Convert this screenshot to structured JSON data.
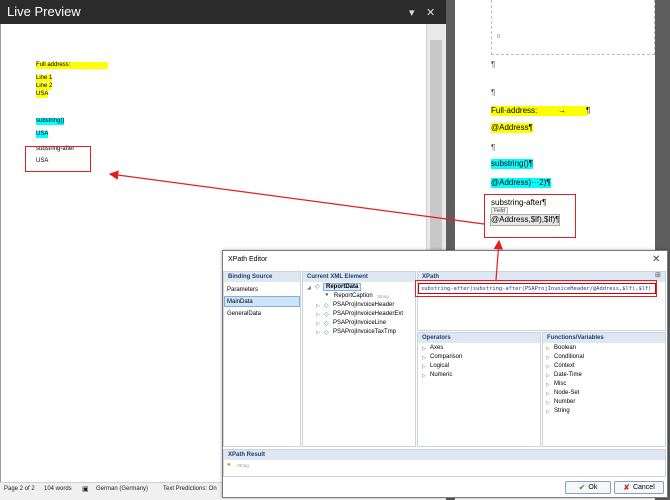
{
  "live_preview": {
    "title": "Live Preview",
    "lines": {
      "full_address": "Full address:",
      "line1": "Line 1",
      "line2": "Line 2",
      "usa1": "USA",
      "substring": "substring()",
      "usa2": "USA",
      "substring_after": "substring-after",
      "usa3": "USA"
    }
  },
  "document": {
    "placeholder": "¤",
    "para1": "¶",
    "para2": "¶",
    "full_address": "Full·address:",
    "tab": "→",
    "full_address_pilcrow": "¶",
    "address_field": "@Address¶",
    "para3": "¶",
    "substring": "substring()¶",
    "address_sub": "@Address)···2)¶",
    "substring_after": "substring-after¶",
    "field_tag": "Field",
    "field_text": "@Address,$lf),$lf)¶"
  },
  "status_bar": {
    "page": "Page 2 of 2",
    "words": "104 words",
    "language": "German (Germany)",
    "predictions": "Text Predictions: On"
  },
  "xpath_editor": {
    "title": "XPath Editor",
    "close": "✕",
    "binding_source": {
      "header": "Binding Source",
      "items": [
        "Parameters",
        "MainData",
        "GeneralData"
      ],
      "selected": "MainData"
    },
    "xml": {
      "header": "Current XML Element",
      "root": "ReportData",
      "caption": "ReportCaption",
      "caption_type": "String",
      "children": [
        "PSAProjInvoiceHeader",
        "PSAProjInvoiceHeaderExt",
        "PSAProjInvoiceLine",
        "PSAProjInvoiceTaxTmp"
      ]
    },
    "xpath": {
      "header": "XPath",
      "value": "substring-after(substring-after(PSAProjInvoiceHeader/@Address,$lf),$lf)"
    },
    "operators": {
      "header": "Operators",
      "items": [
        "Axes",
        "Comparison",
        "Logical",
        "Numeric"
      ]
    },
    "functions": {
      "header": "Functions/Variables",
      "items": [
        "Boolean",
        "Conditional",
        "Context",
        "Date-Time",
        "Misc",
        "Node-Set",
        "Number",
        "String"
      ]
    },
    "result": {
      "header": "XPath Result",
      "value": "String"
    },
    "ok_label": "Ok",
    "cancel_label": "Cancel"
  },
  "colors": {
    "highlight_yellow": "#ffff00",
    "highlight_cyan": "#00ffff",
    "annotation_red": "#e02020"
  }
}
